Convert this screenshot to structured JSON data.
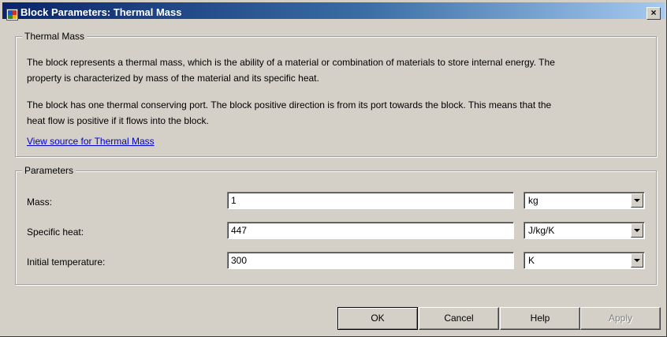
{
  "window": {
    "title": "Block Parameters: Thermal Mass",
    "close_glyph": "×"
  },
  "description": {
    "group_title": "Thermal Mass",
    "paragraph1_line1": "The block represents a thermal mass, which is the ability of a material or combination of materials to store internal energy. The",
    "paragraph1_line2": "property is characterized by mass of the material and its specific heat.",
    "paragraph2_line1": "The block has one thermal conserving port. The block positive direction is from its port towards the block. This means that the",
    "paragraph2_line2": "heat flow is positive if it flows into the block.",
    "source_link": "View source for Thermal Mass"
  },
  "parameters": {
    "group_title": "Parameters",
    "rows": [
      {
        "label": "Mass:",
        "value": "1",
        "unit": "kg"
      },
      {
        "label": "Specific heat:",
        "value": "447",
        "unit": "J/kg/K"
      },
      {
        "label": "Initial temperature:",
        "value": "300",
        "unit": "K"
      }
    ]
  },
  "buttons": {
    "ok": "OK",
    "cancel": "Cancel",
    "help": "Help",
    "apply": "Apply"
  }
}
